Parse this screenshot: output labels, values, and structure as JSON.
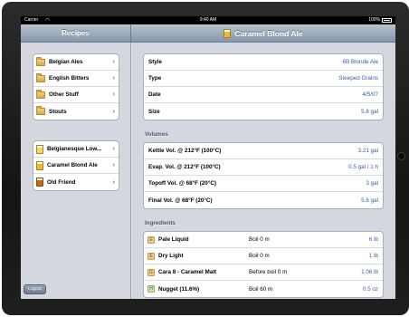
{
  "status": {
    "carrier": "Carrier",
    "time": "9:40 AM",
    "battery": "100%"
  },
  "left_panel": {
    "title": "Recipes",
    "folders": [
      {
        "label": "Belgian Ales"
      },
      {
        "label": "English Bitters"
      },
      {
        "label": "Other Stuff"
      },
      {
        "label": "Stouts"
      }
    ],
    "recipes": [
      {
        "label": "Belgianesque Low...",
        "color": "pale"
      },
      {
        "label": "Caramel Blond Ale",
        "color": "gold"
      },
      {
        "label": "Old Friend",
        "color": "dark"
      }
    ],
    "logout_label": "Logout"
  },
  "detail": {
    "title": "Caramel Blond Ale",
    "info": [
      {
        "key": "Style",
        "value": "6B Blonde Ale"
      },
      {
        "key": "Type",
        "value": "Steeped Grains"
      },
      {
        "key": "Date",
        "value": "4/5/07"
      },
      {
        "key": "Size",
        "value": "5.6 gal"
      }
    ],
    "volumes_header": "Volumes",
    "volumes": [
      {
        "key": "Kettle Vol. @ 212°F (100°C)",
        "value": "3.21 gal"
      },
      {
        "key": "Evap. Vol. @ 212°F (100°C)",
        "value": "0.5 gal / 1 h"
      },
      {
        "key": "Topoff Vol. @ 68°F (20°C)",
        "value": "3 gal"
      },
      {
        "key": "Final Vol. @ 68°F (20°C)",
        "value": "5.6 gal"
      }
    ],
    "ingredients_header": "Ingredients",
    "ingredients": [
      {
        "name": "Pale Liquid",
        "time": "Boil 0 m",
        "amount": "6 lb",
        "kind": "malt",
        "glyph": "E"
      },
      {
        "name": "Dry Light",
        "time": "Boil 0 m",
        "amount": "1 lb",
        "kind": "malt",
        "glyph": "E"
      },
      {
        "name": "Cara 8 - Caramel Malt",
        "time": "Before boil 0 m",
        "amount": "1.06 lb",
        "kind": "malt",
        "glyph": "G"
      },
      {
        "name": "Nugget (11.6%)",
        "time": "Boil 60 m",
        "amount": "0.5 oz",
        "kind": "hop",
        "glyph": "H"
      }
    ]
  },
  "colors": {
    "nav_top": "#b9c3d0",
    "nav_bottom": "#8796aa",
    "value_blue": "#3b5aa6",
    "pane_bg": "#d4d8de"
  }
}
